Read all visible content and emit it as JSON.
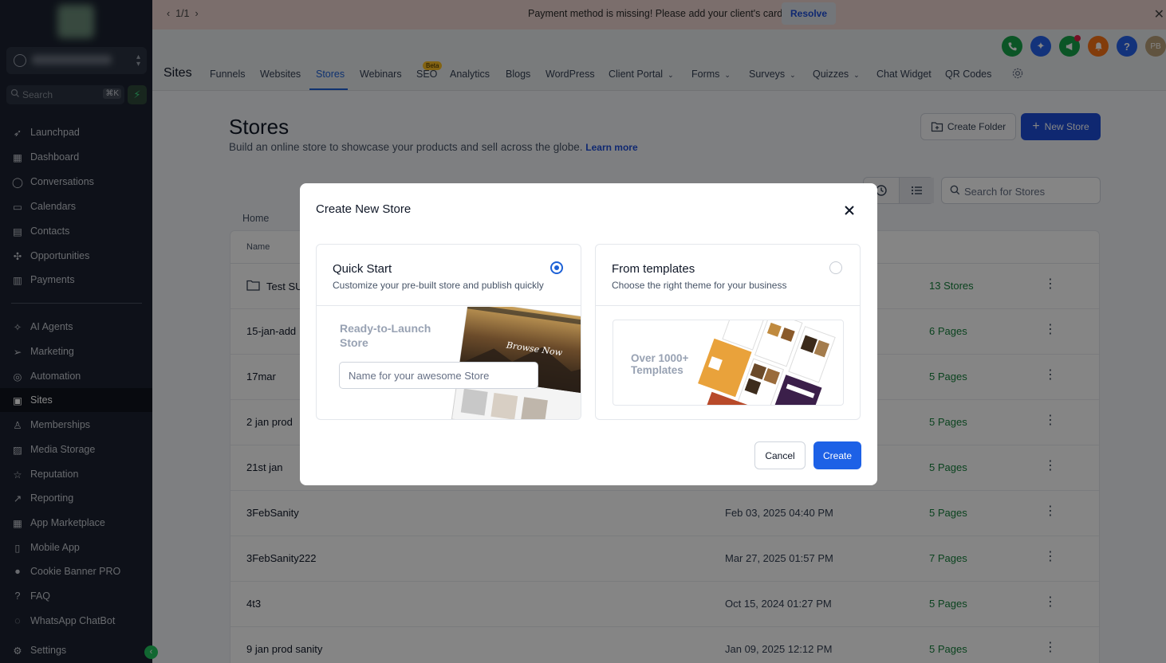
{
  "banner": {
    "pager": "1/1",
    "message": "Payment method is missing! Please add your client's card.",
    "resolve_label": "Resolve"
  },
  "sidebar": {
    "search_placeholder": "Search",
    "search_shortcut": "⌘K",
    "items": [
      {
        "label": "Launchpad",
        "icon": "rocket-icon"
      },
      {
        "label": "Dashboard",
        "icon": "grid-icon"
      },
      {
        "label": "Conversations",
        "icon": "chat-icon"
      },
      {
        "label": "Calendars",
        "icon": "calendar-icon"
      },
      {
        "label": "Contacts",
        "icon": "contacts-icon"
      },
      {
        "label": "Opportunities",
        "icon": "opportunities-icon"
      },
      {
        "label": "Payments",
        "icon": "payments-icon"
      },
      {
        "label": "AI Agents",
        "icon": "sparkle-icon"
      },
      {
        "label": "Marketing",
        "icon": "send-icon"
      },
      {
        "label": "Automation",
        "icon": "automation-icon"
      },
      {
        "label": "Sites",
        "icon": "sites-icon"
      },
      {
        "label": "Memberships",
        "icon": "membership-icon"
      },
      {
        "label": "Media Storage",
        "icon": "image-icon"
      },
      {
        "label": "Reputation",
        "icon": "star-icon"
      },
      {
        "label": "Reporting",
        "icon": "trend-icon"
      },
      {
        "label": "App Marketplace",
        "icon": "apps-icon"
      },
      {
        "label": "Mobile App",
        "icon": "mobile-icon"
      },
      {
        "label": "Cookie Banner PRO",
        "icon": "cookie-icon"
      },
      {
        "label": "FAQ",
        "icon": "question-icon"
      },
      {
        "label": "WhatsApp ChatBot",
        "icon": "whatsapp-icon"
      },
      {
        "label": "Settings",
        "icon": "gear-icon"
      }
    ],
    "active": "Sites"
  },
  "topbar": {
    "avatar_initials": "PB",
    "section_title": "Sites",
    "tabs": [
      "Funnels",
      "Websites",
      "Stores",
      "Webinars",
      "SEO",
      "Analytics",
      "Blogs",
      "WordPress",
      "Client Portal",
      "Forms",
      "Surveys",
      "Quizzes",
      "Chat Widget",
      "QR Codes"
    ],
    "active_tab": "Stores",
    "beta_badge": "Beta"
  },
  "page": {
    "title": "Stores",
    "subtitle": "Build an online store to showcase your products and sell across the globe.",
    "learn_more": "Learn more",
    "create_folder_label": "Create Folder",
    "new_store_label": "New Store",
    "search_placeholder": "Search for Stores",
    "breadcrumb": "Home"
  },
  "table": {
    "header_name": "Name",
    "rows": [
      {
        "name": "Test SU",
        "date": "",
        "count": "13 Stores",
        "folder": true
      },
      {
        "name": "15-jan-add",
        "date": "",
        "count": "6 Pages"
      },
      {
        "name": "17mar",
        "date": "",
        "count": "5 Pages"
      },
      {
        "name": "2 jan prod",
        "date": "",
        "count": "5 Pages"
      },
      {
        "name": "21st jan",
        "date": "",
        "count": "5 Pages"
      },
      {
        "name": "3FebSanity",
        "date": "Feb 03, 2025 04:40 PM",
        "count": "5 Pages"
      },
      {
        "name": "3FebSanity222",
        "date": "Mar 27, 2025 01:57 PM",
        "count": "7 Pages"
      },
      {
        "name": "4t3",
        "date": "Oct 15, 2024 01:27 PM",
        "count": "5 Pages"
      },
      {
        "name": "9 jan prod sanity",
        "date": "Jan 09, 2025 12:12 PM",
        "count": "5 Pages"
      }
    ]
  },
  "modal": {
    "title": "Create New Store",
    "quick_start": {
      "title": "Quick Start",
      "description": "Customize your pre-built store and publish quickly",
      "preview_text": "Ready-to-Launch Store",
      "preview_banner": "Browse Now",
      "input_placeholder": "Name for your awesome Store",
      "selected": true
    },
    "templates": {
      "title": "From templates",
      "description": "Choose the right theme for your business",
      "preview_text": "Over 1000+ Templates",
      "selected": false
    },
    "cancel_label": "Cancel",
    "create_label": "Create"
  },
  "colors": {
    "primary": "#1d4ed8",
    "sidebar_bg": "#1b2230",
    "banner_bg": "#ecd3cf",
    "success": "#16803c"
  }
}
